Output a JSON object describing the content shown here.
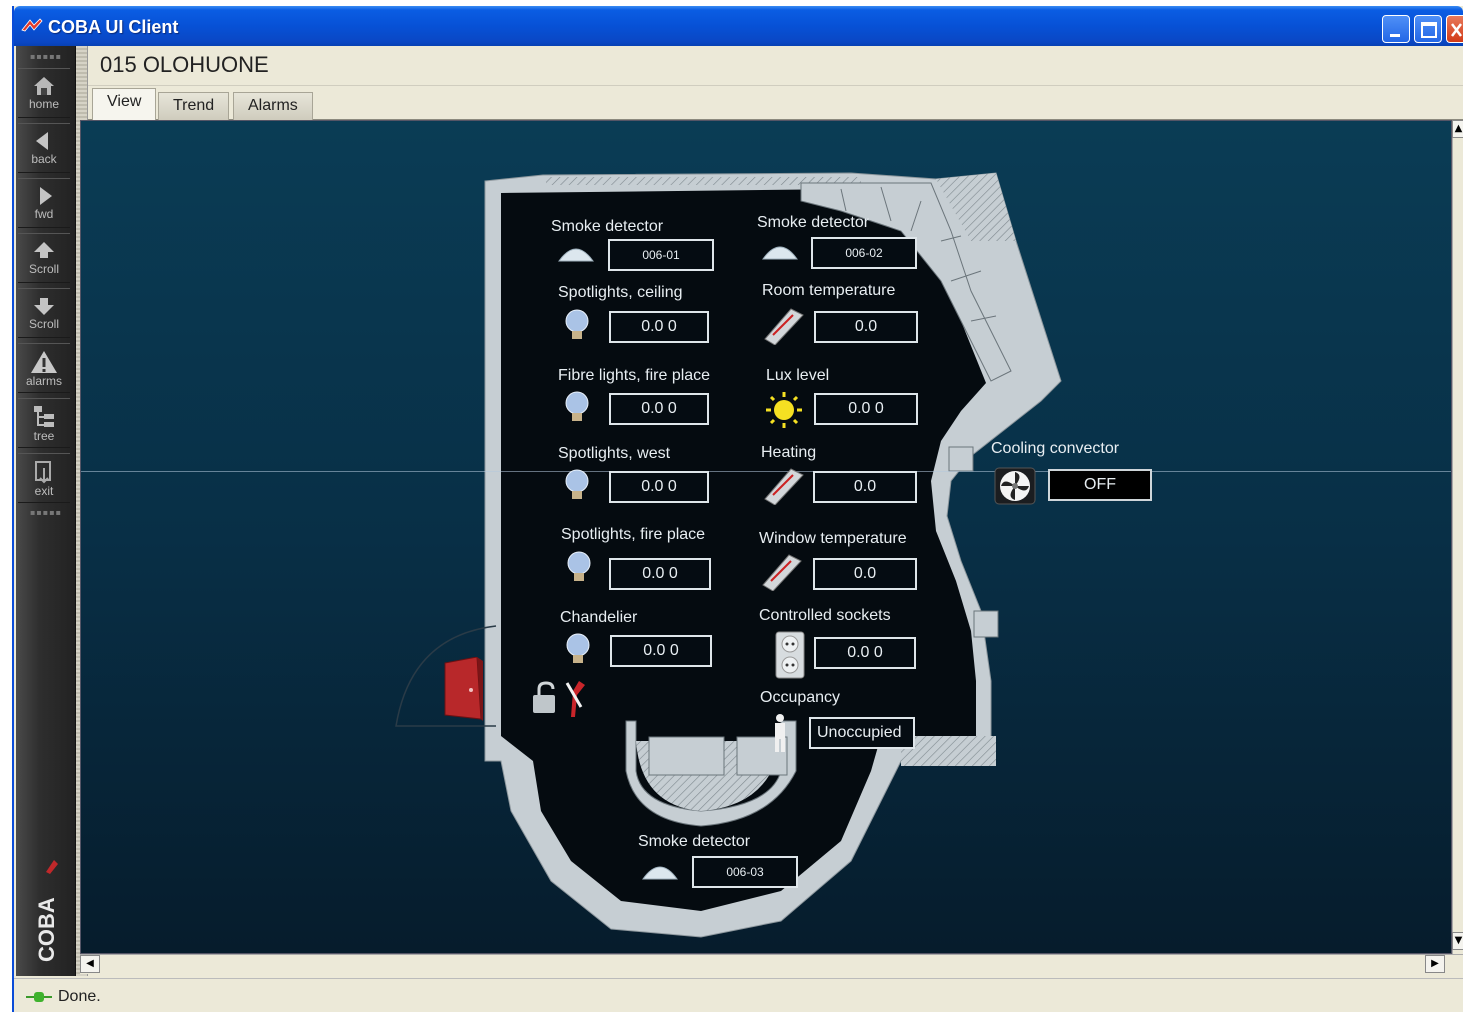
{
  "window": {
    "title": "COBA UI Client"
  },
  "sidebar": {
    "items": [
      {
        "label": "home",
        "icon": "home-icon"
      },
      {
        "label": "back",
        "icon": "back-arrow-icon"
      },
      {
        "label": "fwd",
        "icon": "forward-arrow-icon"
      },
      {
        "label": "Scroll",
        "icon": "scroll-up-icon"
      },
      {
        "label": "Scroll",
        "icon": "scroll-down-icon"
      },
      {
        "label": "alarms",
        "icon": "alarm-icon"
      },
      {
        "label": "tree",
        "icon": "tree-icon"
      },
      {
        "label": "exit",
        "icon": "exit-icon"
      }
    ],
    "brand": "COBA"
  },
  "header": {
    "title": "015 OLOHUONE"
  },
  "tabs": [
    {
      "label": "View",
      "active": true
    },
    {
      "label": "Trend",
      "active": false
    },
    {
      "label": "Alarms",
      "active": false
    }
  ],
  "floorplan": {
    "smoke_detector_1": {
      "label": "Smoke detector",
      "value": "006-01"
    },
    "smoke_detector_2": {
      "label": "Smoke detector",
      "value": "006-02"
    },
    "spotlights_ceiling": {
      "label": "Spotlights, ceiling",
      "value": "0.0 0"
    },
    "room_temperature": {
      "label": "Room temperature",
      "value": "0.0"
    },
    "fibre_lights": {
      "label": "Fibre lights, fire place",
      "value": "0.0 0"
    },
    "lux_level": {
      "label": "Lux level",
      "value": "0.0 0"
    },
    "spotlights_west": {
      "label": "Spotlights, west",
      "value": "0.0 0"
    },
    "heating": {
      "label": "Heating",
      "value": "0.0"
    },
    "cooling_convector": {
      "label": "Cooling convector",
      "value": "OFF"
    },
    "spotlights_fireplace": {
      "label": "Spotlights, fire place",
      "value": "0.0 0"
    },
    "window_temperature": {
      "label": "Window temperature",
      "value": "0.0"
    },
    "chandelier": {
      "label": "Chandelier",
      "value": "0.0 0"
    },
    "controlled_sockets": {
      "label": "Controlled sockets",
      "value": "0.0 0"
    },
    "occupancy": {
      "label": "Occupancy",
      "value": "Unoccupied"
    },
    "smoke_detector_3": {
      "label": "Smoke detector",
      "value": "006-03"
    }
  },
  "status": {
    "text": "Done."
  },
  "colors": {
    "canvas_top": "#0a3c55",
    "canvas_bottom": "#061c2c",
    "titlebar": "#0751d6",
    "wall": "#c6ced3",
    "door": "#b8282a"
  }
}
